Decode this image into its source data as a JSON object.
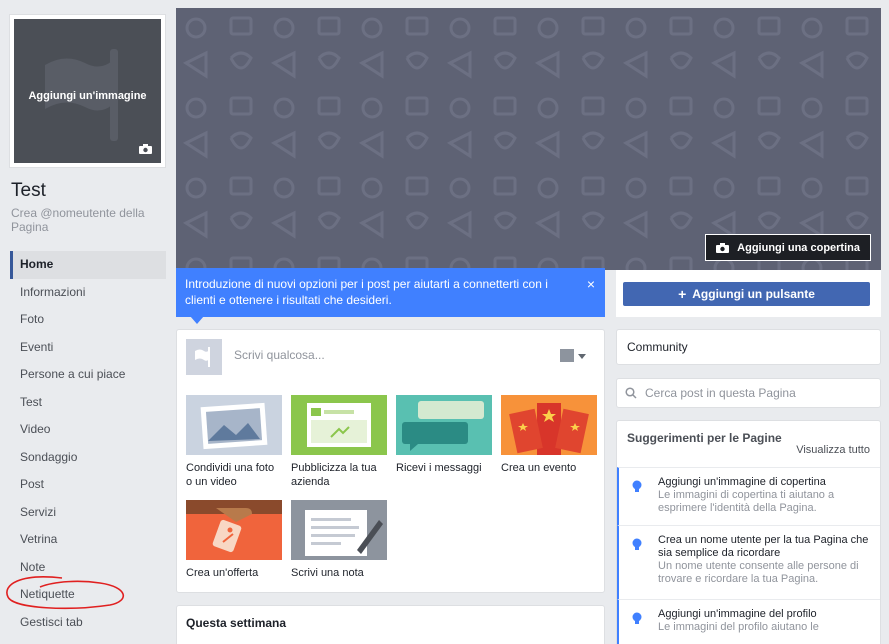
{
  "sidebar": {
    "profile_label": "Aggiungi un'immagine",
    "page_title": "Test",
    "username_hint": "Crea @nomeutente della Pagina",
    "items": [
      {
        "label": "Home"
      },
      {
        "label": "Informazioni"
      },
      {
        "label": "Foto"
      },
      {
        "label": "Eventi"
      },
      {
        "label": "Persone a cui piace"
      },
      {
        "label": "Test"
      },
      {
        "label": "Video"
      },
      {
        "label": "Sondaggio"
      },
      {
        "label": "Post"
      },
      {
        "label": "Servizi"
      },
      {
        "label": "Vetrina"
      },
      {
        "label": "Note"
      },
      {
        "label": "Netiquette"
      },
      {
        "label": "Gestisci tab"
      }
    ]
  },
  "cover": {
    "button_label": "Aggiungi una copertina"
  },
  "banner": {
    "text": "Introduzione di nuovi opzioni per i post per aiutarti a connetterti con i clienti e ottenere i risultati che desideri.",
    "close": "×"
  },
  "actions": {
    "add_button_label": "Aggiungi un pulsante",
    "add_button_icon": "+"
  },
  "composer": {
    "placeholder": "Scrivi qualcosa...",
    "tiles": [
      {
        "label": "Condividi una foto o un video"
      },
      {
        "label": "Pubblicizza la tua azienda"
      },
      {
        "label": "Ricevi i messaggi"
      },
      {
        "label": "Crea un evento"
      },
      {
        "label": "Crea un'offerta"
      },
      {
        "label": "Scrivi una nota"
      }
    ]
  },
  "week": {
    "title": "Questa settimana"
  },
  "right": {
    "community_label": "Community",
    "search_placeholder": "Cerca post in questa Pagina",
    "suggestions_title": "Suggerimenti per le Pagine",
    "see_all": "Visualizza tutto",
    "suggestions": [
      {
        "title": "Aggiungi un'immagine di copertina",
        "desc": "Le immagini di copertina ti aiutano a esprimere l'identità della Pagina."
      },
      {
        "title": "Crea un nome utente per la tua Pagina che sia semplice da ricordare",
        "desc": "Un nome utente consente alle persone di trovare e ricordare la tua Pagina."
      },
      {
        "title": "Aggiungi un'immagine del profilo",
        "desc": "Le immagini del profilo aiutano le"
      }
    ]
  },
  "colors": {
    "brand_blue": "#4267b2",
    "banner_blue": "#4080ff",
    "cover_gray": "#5e6274",
    "annotation_red": "#e02020"
  }
}
